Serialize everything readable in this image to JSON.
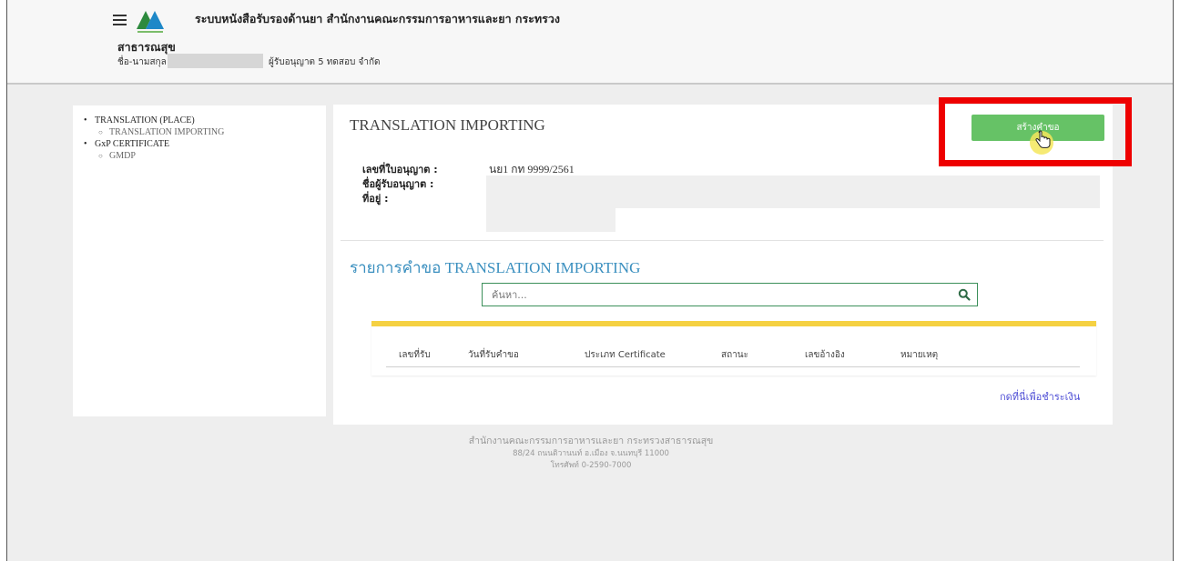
{
  "header": {
    "app_title_line1": "ระบบหนังสือรับรองด้านยา สำนักงานคณะกรรมการอาหารและยา กระทรวง",
    "app_title_line2": "สาธารณสุข",
    "user_label": "ชื่อ-นามสกุล",
    "licensee": "ผู้รับอนุญาต 5 ทดสอบ จำกัด"
  },
  "sidebar": {
    "groups": [
      {
        "label": "TRANSLATION (PLACE)",
        "items": [
          "TRANSLATION IMPORTING"
        ]
      },
      {
        "label": "GxP CERTIFICATE",
        "items": [
          "GMDP"
        ]
      }
    ]
  },
  "main": {
    "title": "TRANSLATION IMPORTING",
    "create_button": "สร้างคำขอ",
    "info": {
      "license_no_label": "เลขที่ใบอนุญาต :",
      "license_no_value": "นย1 กท 9999/2561",
      "licensee_name_label": "ชื่อผู้รับอนุญาต :",
      "address_label": "ที่อยู่ :"
    },
    "list_title": "รายการคำขอ TRANSLATION IMPORTING",
    "search": {
      "placeholder": "ค้นหา..."
    },
    "table": {
      "columns": [
        "เลขที่รับ",
        "วันที่รับคำขอ",
        "ประเภท Certificate",
        "สถานะ",
        "เลขอ้างอิง",
        "หมายเหตุ"
      ]
    },
    "pay_link": "กดที่นี่เพื่อชำระเงิน"
  },
  "footer": {
    "line1": "สำนักงานคณะกรรมการอาหารและยา กระทรวงสาธารณสุข",
    "line2": "88/24 ถนนติวานนท์ อ.เมือง จ.นนทบุรี 11000",
    "line3": "โทรศัพท์ 0-2590-7000"
  },
  "colors": {
    "accent_green": "#66c266",
    "highlight_red": "#ee0000",
    "table_top_yellow": "#f5d142",
    "list_title_blue": "#3a8fbf",
    "link_blue": "#5050d6"
  },
  "icons": {
    "menu": "hamburger-icon",
    "logo": "fda-logo",
    "search": "search-icon",
    "cursor": "hand-pointer-icon"
  }
}
